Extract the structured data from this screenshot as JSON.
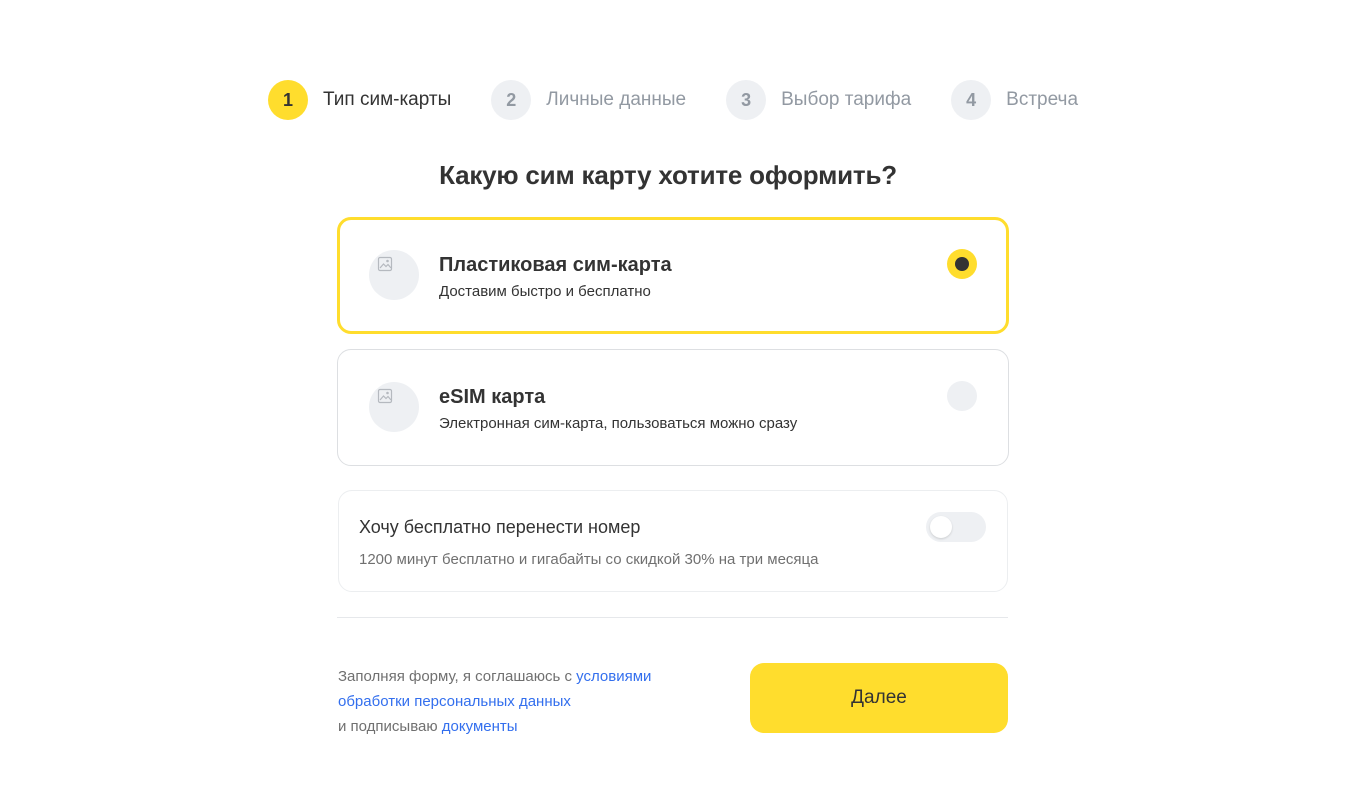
{
  "stepper": {
    "steps": [
      {
        "number": "1",
        "label": "Тип сим-карты"
      },
      {
        "number": "2",
        "label": "Личные данные"
      },
      {
        "number": "3",
        "label": "Выбор тарифа"
      },
      {
        "number": "4",
        "label": "Встреча"
      }
    ],
    "active_step": 1
  },
  "page_title": "Какую сим карту хотите оформить?",
  "options": [
    {
      "title": "Пластиковая сим-карта",
      "subtitle": "Доставим быстро и бесплатно",
      "icon": "image-placeholder-icon",
      "selected": true
    },
    {
      "title": "eSIM карта",
      "subtitle": "Электронная сим-карта, пользоваться можно сразу",
      "icon": "image-placeholder-icon",
      "selected": false
    }
  ],
  "number_transfer": {
    "title": "Хочу бесплатно перенести номер",
    "subtitle": "1200 минут бесплатно и гигабайты со скидкой 30% на три месяца",
    "enabled": false
  },
  "consent": {
    "prefix": "Заполняя форму, я соглашаюсь с ",
    "link1": "условиями обработки персональных данных",
    "middle": "и подписываю ",
    "link2": "документы"
  },
  "next_button": {
    "label": "Далее"
  },
  "colors": {
    "accent": "#ffdd2d",
    "text": "#333333",
    "muted": "#9299a2",
    "link": "#336fee",
    "inactive_bg": "#eef0f3"
  }
}
